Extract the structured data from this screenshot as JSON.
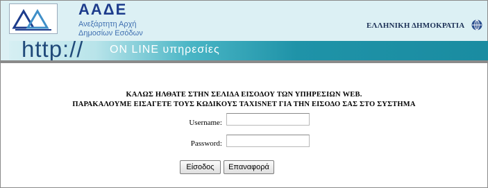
{
  "header": {
    "brand_name": "ΑΑΔΕ",
    "brand_sub_line1": "Ανεξάρτητη Αρχή",
    "brand_sub_line2": "Δημοσίων Εσόδων",
    "republic": "ΕΛΛΗΝΙΚΗ ΔΗΜΟΚΡΑΤΙΑ",
    "banner_http": "http://",
    "banner_online": "ON LINE υπηρεσίες",
    "logo_icon": "aade-logo-icon",
    "globe_icon": "globe-icon"
  },
  "main": {
    "welcome_line1": "ΚΑΛΩΣ ΗΛΘΑΤΕ ΣΤΗΝ ΣΕΛΙΔΑ ΕΙΣΟΔΟΥ ΤΩΝ ΥΠΗΡΕΣΙΩΝ WEB.",
    "welcome_line2": "ΠΑΡΑΚΑΛΟΥΜΕ ΕΙΣΑΓΕΤΕ ΤΟΥΣ ΚΩΔΙΚΟΥΣ TAXISNET ΓΙΑ ΤΗΝ ΕΙΣΟΔΟ ΣΑΣ ΣΤΟ ΣΥΣΤΗΜΑ",
    "username_label": "Username:",
    "username_value": "",
    "password_label": "Password:",
    "password_value": "",
    "login_button": "Είσοδος",
    "reset_button": "Επαναφορά"
  },
  "colors": {
    "header_bg": "#dcf0f4",
    "brand_blue": "#1d3c8c",
    "banner_teal": "#1a8ca1"
  }
}
